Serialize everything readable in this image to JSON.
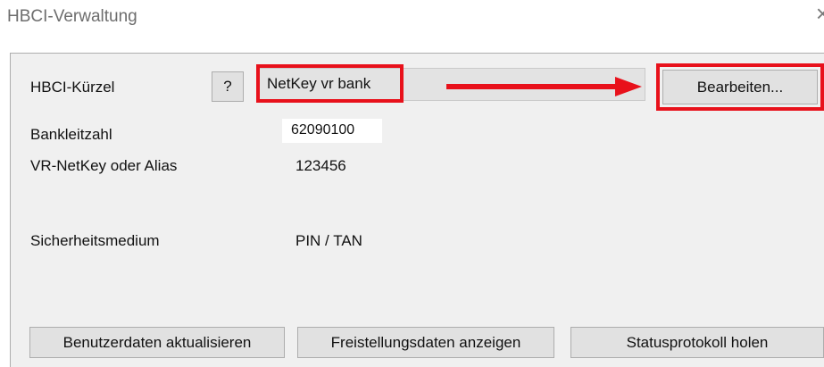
{
  "window": {
    "title": "HBCI-Verwaltung",
    "close_glyph": "×"
  },
  "fields": {
    "kuerzel_label": "HBCI-Kürzel",
    "help_label": "?",
    "kuerzel_value": "NetKey vr bank",
    "edit_label": "Bearbeiten...",
    "blz_label": "Bankleitzahl",
    "blz_value": "62090100",
    "alias_label": "VR-NetKey oder Alias",
    "alias_value": "123456",
    "medium_label": "Sicherheitsmedium",
    "medium_value": "PIN / TAN"
  },
  "buttons": {
    "update_user": "Benutzerdaten aktualisieren",
    "show_exemption": "Freistellungsdaten anzeigen",
    "get_status": "Statusprotokoll holen"
  },
  "annotation": {
    "highlight_color": "#e8111b",
    "arrow_icon": "red-right-arrow"
  }
}
